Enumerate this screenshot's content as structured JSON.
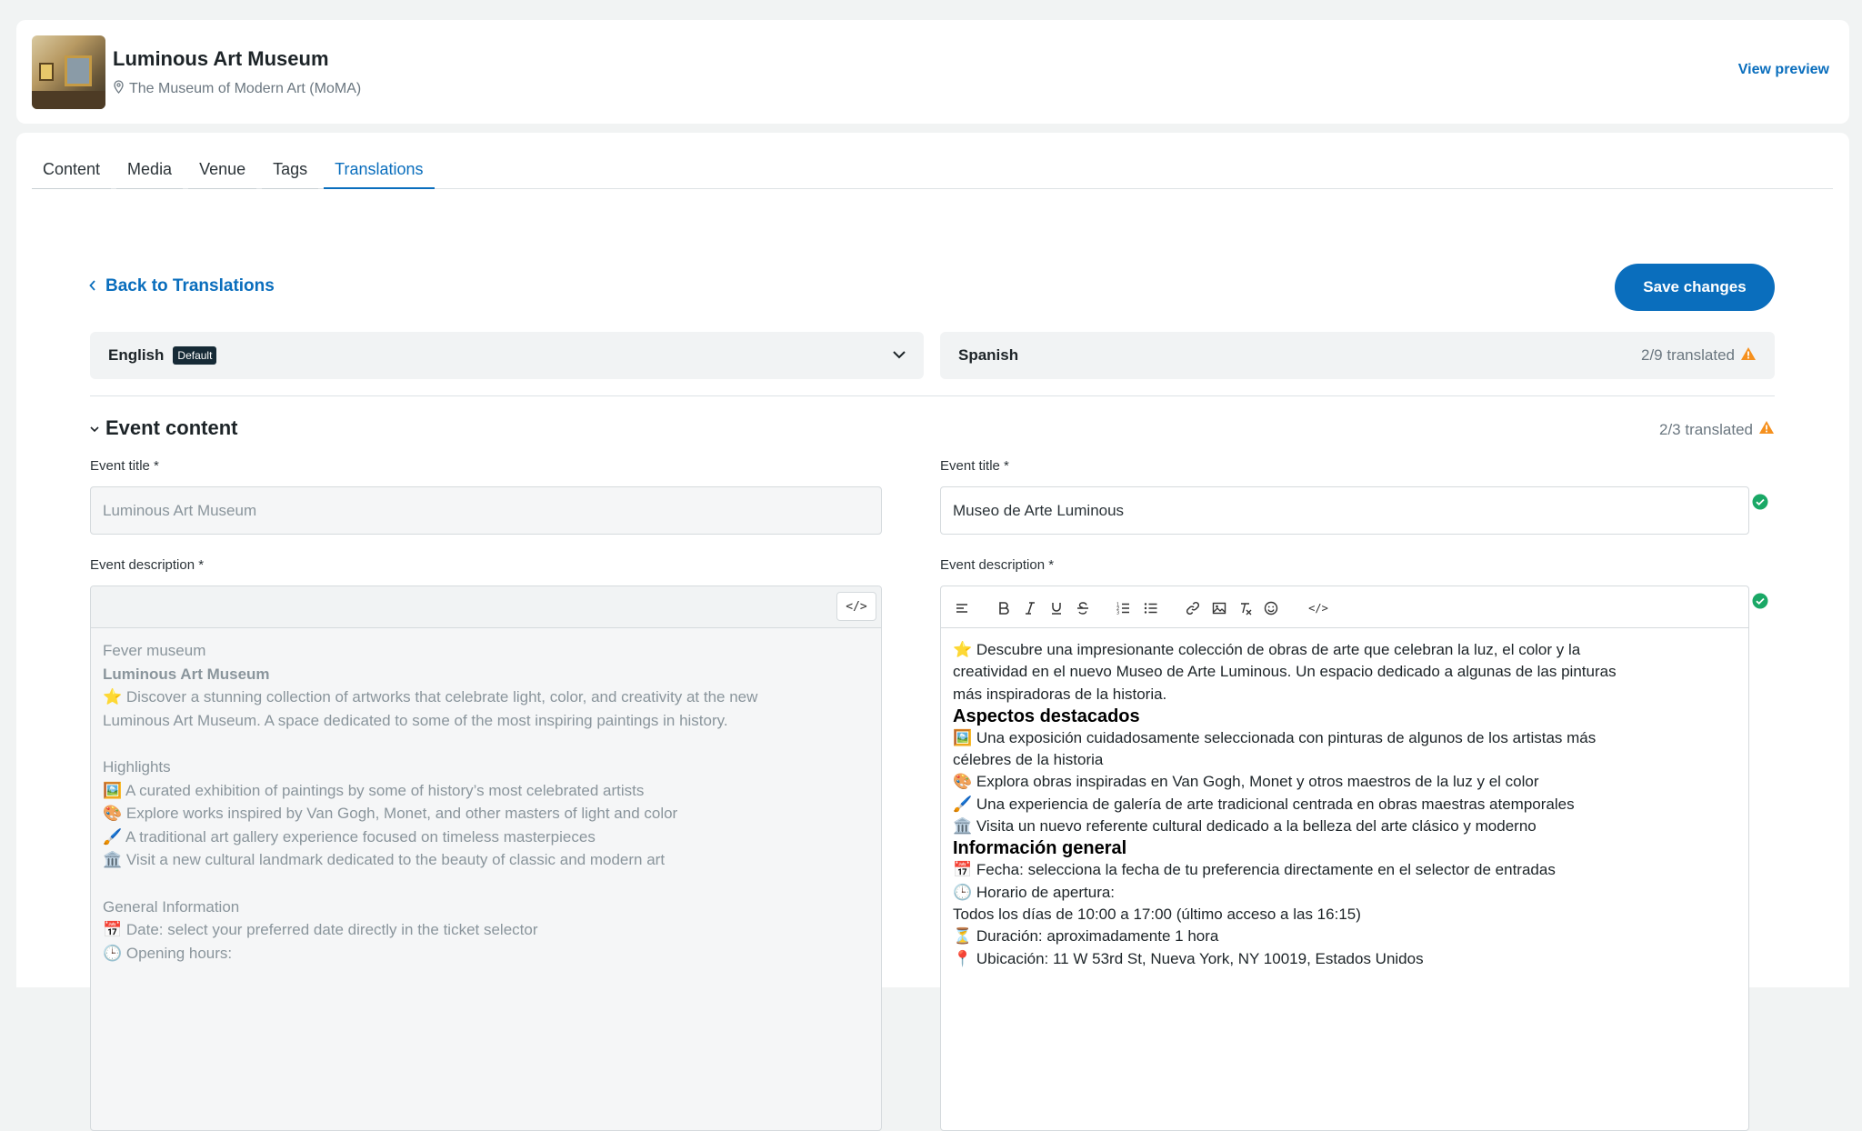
{
  "header": {
    "event_name": "Luminous Art Museum",
    "venue": "The Museum of Modern Art (MoMA)",
    "view_preview": "View preview"
  },
  "tabs": [
    {
      "label": "Content",
      "active": false
    },
    {
      "label": "Media",
      "active": false
    },
    {
      "label": "Venue",
      "active": false
    },
    {
      "label": "Tags",
      "active": false
    },
    {
      "label": "Translations",
      "active": true
    }
  ],
  "back_link": "Back to Translations",
  "save_button": "Save changes",
  "source_language": {
    "name": "English",
    "badge": "Default"
  },
  "target_language": {
    "name": "Spanish",
    "status": "2/9 translated"
  },
  "section": {
    "title": "Event content",
    "status": "2/3 translated"
  },
  "fields": {
    "title_label": "Event title *",
    "title_source": "Luminous Art Museum",
    "title_target": "Museo de Arte Luminous",
    "description_label": "Event description *"
  },
  "code_button": "</>",
  "source_description": {
    "l1": "Fever museum",
    "l2": "Luminous Art Museum",
    "l3": "⭐ Discover a stunning collection of artworks that celebrate light, color, and creativity at the new",
    "l4": "Luminous Art Museum. A space dedicated to some of the most inspiring paintings in history.",
    "l5": "Highlights",
    "l6": "🖼️ A curated exhibition of paintings by some of history’s most celebrated artists",
    "l7": "🎨 Explore works inspired by Van Gogh, Monet, and other masters of light and color",
    "l8": "🖌️ A traditional art gallery experience focused on timeless masterpieces",
    "l9": "🏛️ Visit a new cultural landmark dedicated to the beauty of classic and modern art",
    "l10": "General Information",
    "l11": "📅 Date: select your preferred date directly in the ticket selector",
    "l12": "🕒 Opening hours:"
  },
  "target_description": {
    "l1": "⭐ Descubre una impresionante colección de obras de arte que celebran la luz, el color y la",
    "l2": "creatividad en el nuevo Museo de Arte Luminous. Un espacio dedicado a algunas de las pinturas",
    "l3": "más inspiradoras de la historia.",
    "h1": "Aspectos destacados",
    "l4": "🖼️ Una exposición cuidadosamente seleccionada con pinturas de algunos de los artistas más",
    "l5": "célebres de la historia",
    "l6": " 🎨 Explora obras inspiradas en Van Gogh, Monet y otros maestros de la luz y el color",
    "l7": " 🖌️ Una experiencia de galería de arte tradicional centrada en obras maestras atemporales",
    "l8": " 🏛️ Visita un nuevo referente cultural dedicado a la belleza del arte clásico y moderno",
    "h2": "Información general",
    "l9": "📅 Fecha: selecciona la fecha de tu preferencia directamente en el selector de entradas",
    "l10": " 🕒 Horario de apertura:",
    "l11": " Todos los días de 10:00 a 17:00 (último acceso a las 16:15)",
    "l12": " ⏳ Duración: aproximadamente 1 hora",
    "l13": " 📍 Ubicación: 11 W 53rd St, Nueva York, NY 10019, Estados Unidos"
  },
  "colors": {
    "accent": "#0a6ebd",
    "warning": "#f5901e",
    "success": "#1aa866",
    "badge": "#162a36"
  }
}
